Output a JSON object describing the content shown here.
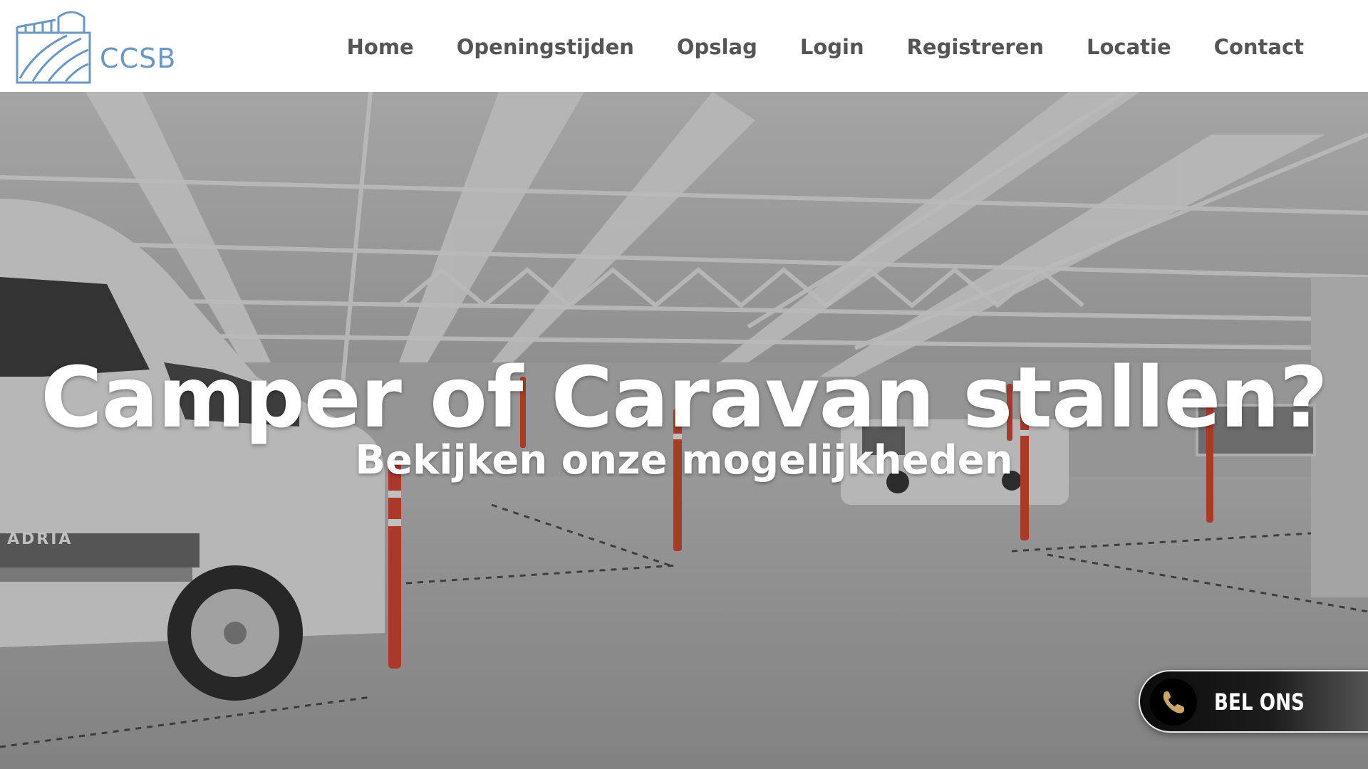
{
  "header": {
    "logo_text": "CCSB",
    "nav": [
      {
        "label": "Home"
      },
      {
        "label": "Openingstijden"
      },
      {
        "label": "Opslag"
      },
      {
        "label": "Login"
      },
      {
        "label": "Registreren"
      },
      {
        "label": "Locatie"
      },
      {
        "label": "Contact"
      }
    ]
  },
  "hero": {
    "title": "Camper of Caravan stallen?",
    "subtitle": "Bekijken onze mogelijkheden",
    "van_brand": "ADRIA"
  },
  "call_button": {
    "label": "BEL ONS",
    "icon": "phone-icon"
  },
  "colors": {
    "logo": "#6a97c4",
    "nav_text": "#555555",
    "hero_text": "#ffffff",
    "cone": "#e0442e",
    "phone_icon": "#c9a56a"
  }
}
